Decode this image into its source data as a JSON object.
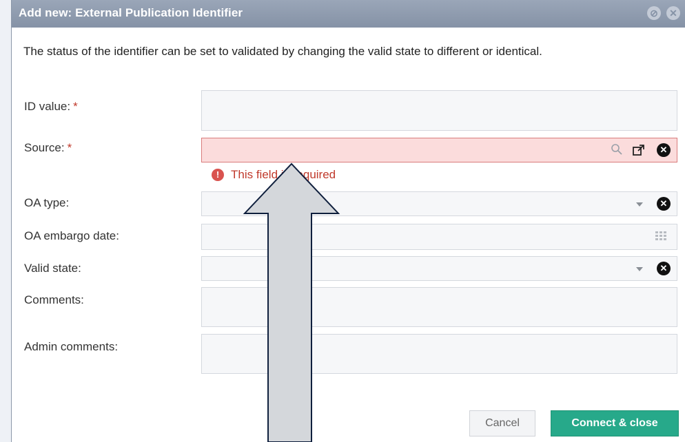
{
  "dialog": {
    "title": "Add new: External Publication Identifier",
    "help_icon": "help-icon",
    "close_icon": "close-icon",
    "intro": "The status of the identifier can be set to validated by changing the valid state to different or identical."
  },
  "form": {
    "id_value": {
      "label": "ID value:",
      "required": "*",
      "value": ""
    },
    "source": {
      "label": "Source:",
      "required": "*",
      "value": "",
      "error": "This field is required",
      "icons": [
        "search-icon",
        "open-external-icon",
        "clear-icon"
      ]
    },
    "oa_type": {
      "label": "OA type:",
      "value": ""
    },
    "oa_embargo_date": {
      "label": "OA embargo date:",
      "value": ""
    },
    "valid_state": {
      "label": "Valid state:",
      "value": ""
    },
    "comments": {
      "label": "Comments:",
      "value": ""
    },
    "admin_comments": {
      "label": "Admin comments:",
      "value": ""
    }
  },
  "buttons": {
    "cancel": "Cancel",
    "connect_close": "Connect & close"
  },
  "colors": {
    "titlebar": "#8d99ac",
    "error": "#c0392b",
    "error_field": "#fbdcdc",
    "primary": "#27a98a"
  }
}
